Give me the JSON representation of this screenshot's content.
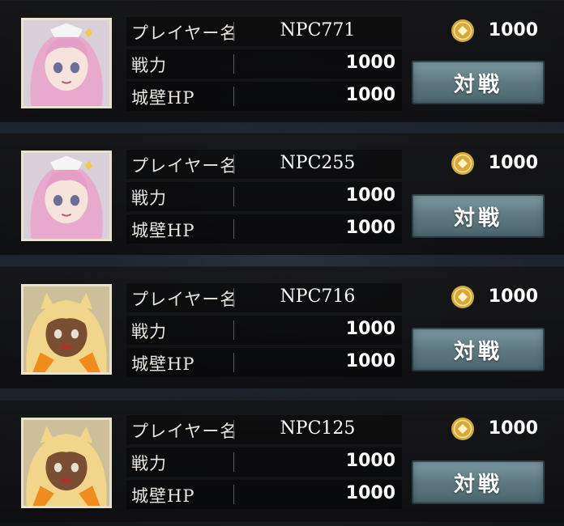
{
  "labels": {
    "player_name": "プレイヤー名",
    "power": "戦力",
    "wall_hp": "城壁HP",
    "battle_button": "対戦"
  },
  "opponents": [
    {
      "avatar": "pink-hair-girl-avatar",
      "name": "NPC771",
      "coins": "1000",
      "power": "1000",
      "wall_hp": "1000"
    },
    {
      "avatar": "pink-hair-girl-avatar",
      "name": "NPC255",
      "coins": "1000",
      "power": "1000",
      "wall_hp": "1000"
    },
    {
      "avatar": "blonde-cat-girl-avatar",
      "name": "NPC716",
      "coins": "1000",
      "power": "1000",
      "wall_hp": "1000"
    },
    {
      "avatar": "blonde-cat-girl-avatar",
      "name": "NPC125",
      "coins": "1000",
      "power": "1000",
      "wall_hp": "1000"
    }
  ],
  "colors": {
    "button": "#5d7880",
    "coin": "#d7a93a",
    "avatar_border": "#e8e2cf"
  },
  "icons": {
    "coin": "gold-coin-icon"
  }
}
